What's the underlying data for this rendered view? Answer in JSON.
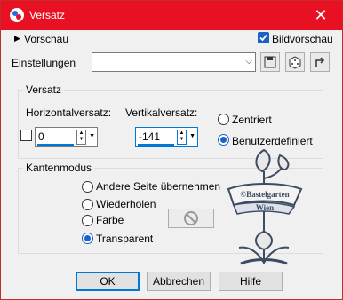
{
  "window": {
    "title": "Versatz",
    "close_glyph": "✕"
  },
  "top": {
    "preview_toggle": "Vorschau",
    "preview_arrow": "▶",
    "image_preview_label": "Bildvorschau",
    "image_preview_checked": true
  },
  "settings": {
    "label": "Einstellungen",
    "value": "",
    "arrow": "⌵"
  },
  "offset_group": {
    "title": "Versatz",
    "horizontal_label": "Horizontalversatz:",
    "horizontal_value": "0",
    "vertical_label": "Vertikalversatz:",
    "vertical_value": "-141",
    "centered_label": "Zentriert",
    "custom_label": "Benutzerdefiniert",
    "selected": "custom"
  },
  "edge_group": {
    "title": "Kantenmodus",
    "options": [
      "Andere Seite übernehmen",
      "Wiederholen",
      "Farbe",
      "Transparent"
    ],
    "selected": "Transparent"
  },
  "watermark": {
    "line1": "©Bastelgarten",
    "line2": "Wien"
  },
  "buttons": {
    "ok": "OK",
    "cancel": "Abbrechen",
    "help": "Hilfe"
  },
  "colors": {
    "titlebar": "#e81123",
    "accent": "#0078d7",
    "checkbox": "#1a62c5"
  }
}
